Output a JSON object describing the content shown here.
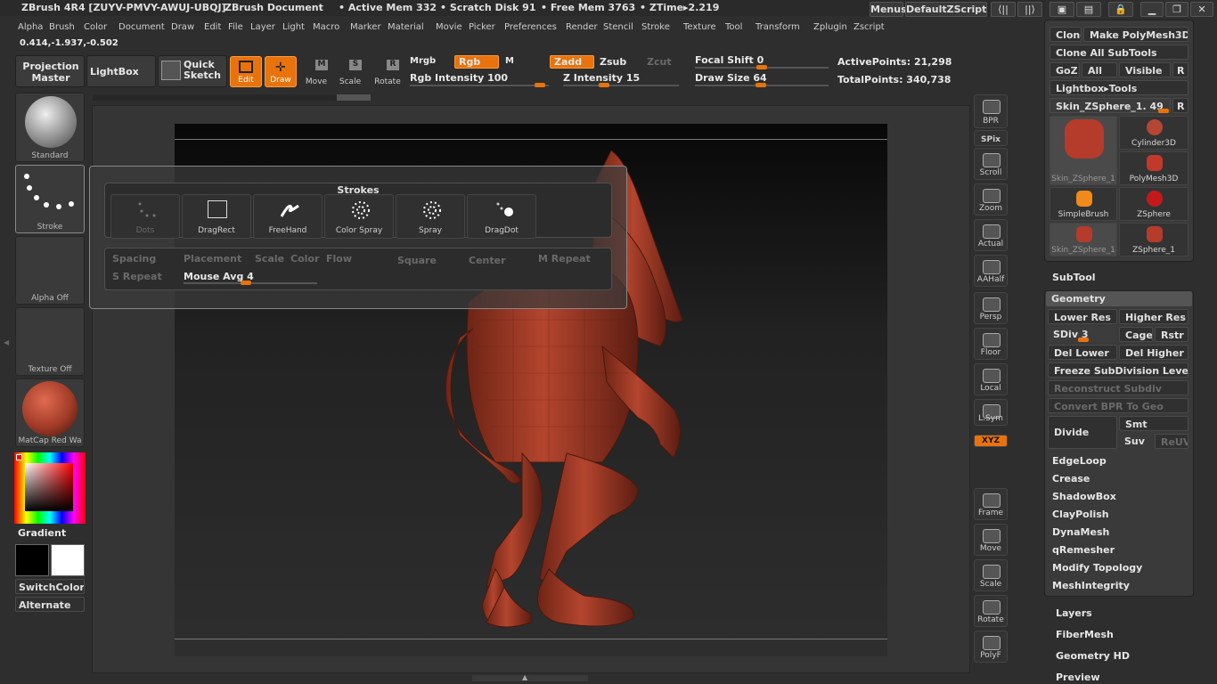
{
  "title_bar": {
    "app": "ZBrush 4R4 [ZUYV-PMVY-AWUJ-UBQJ]",
    "document": "ZBrush Document",
    "active_mem": "• Active Mem 332",
    "scratch": "• Scratch Disk 91",
    "free_mem": "• Free Mem 3763",
    "ztime": "• ZTime▸2.219",
    "menus_label": "Menus",
    "script_label": "DefaultZScript"
  },
  "menu": [
    "Alpha",
    "Brush",
    "Color",
    "Document",
    "Draw",
    "Edit",
    "File",
    "Layer",
    "Light",
    "Macro",
    "Marker",
    "Material",
    "Movie",
    "Picker",
    "Preferences",
    "Render",
    "Stencil",
    "Stroke",
    "Texture",
    "Tool",
    "Transform",
    "Zplugin",
    "Zscript"
  ],
  "coords": "0.414,-1.937,-0.502",
  "toolbar": {
    "projection_master": "Projection Master",
    "lightbox": "LightBox",
    "quick_sketch": "Quick Sketch",
    "edit": "Edit",
    "draw": "Draw",
    "move": "Move",
    "scale": "Scale",
    "rotate": "Rotate",
    "mrgb": "Mrgb",
    "rgb": "Rgb",
    "m": "M",
    "zadd": "Zadd",
    "zsub": "Zsub",
    "zcut": "Zcut",
    "rgb_intensity": "Rgb Intensity 100",
    "z_intensity": "Z Intensity 15",
    "focal_shift": "Focal Shift 0",
    "draw_size": "Draw Size 64",
    "active_points": "ActivePoints: 21,298",
    "total_points": "TotalPoints: 340,738"
  },
  "left": {
    "standard": "Standard",
    "stroke": "Stroke",
    "alpha": "Alpha Off",
    "texture": "Texture Off",
    "matcap": "MatCap Red Wa",
    "gradient": "Gradient",
    "switch_color": "SwitchColor",
    "alternate": "Alternate"
  },
  "popup": {
    "title": "Strokes",
    "strokes": [
      "Dots",
      "DragRect",
      "FreeHand",
      "Color Spray",
      "Spray",
      "DragDot"
    ],
    "options": [
      "Spacing",
      "Placement",
      "Scale",
      "Color",
      "Flow",
      "Square",
      "Center",
      "M Repeat",
      "S Repeat"
    ],
    "mouse_avg": "Mouse Avg 4"
  },
  "right_shelf": [
    "BPR",
    "SPix",
    "Scroll",
    "Zoom",
    "Actual",
    "AAHalf",
    "Persp",
    "Floor",
    "Local",
    "L.Sym",
    "XYZ",
    "Frame",
    "Move",
    "Scale",
    "Rotate",
    "PolyF"
  ],
  "tool_panel": {
    "clone": "Clone",
    "make_polymesh": "Make PolyMesh3D",
    "clone_all": "Clone All SubTools",
    "goz": "GoZ",
    "all": "All",
    "visible": "Visible",
    "r": "R",
    "lightbox_tools": "Lightbox▸Tools",
    "current_tool": "Skin_ZSphere_1. 49",
    "tools": [
      "Skin_ZSphere_1",
      "Cylinder3D",
      "PolyMesh3D",
      "SimpleBrush",
      "ZSphere",
      "Skin_ZSphere_1",
      "ZSphere_1"
    ],
    "subtool": "SubTool",
    "geometry": "Geometry",
    "lower_res": "Lower Res",
    "higher_res": "Higher Res",
    "sdiv": "SDiv 3",
    "cage": "Cage",
    "rstr": "Rstr",
    "del_lower": "Del Lower",
    "del_higher": "Del Higher",
    "freeze": "Freeze SubDivision Levels",
    "reconstruct": "Reconstruct Subdiv",
    "convert_bpr": "Convert BPR To Geo",
    "divide": "Divide",
    "smt": "Smt",
    "suv": "Suv",
    "reuv": "ReUV",
    "geo_items": [
      "EdgeLoop",
      "Crease",
      "ShadowBox",
      "ClayPolish",
      "DynaMesh",
      "qRemesher",
      "Modify Topology",
      "MeshIntegrity"
    ],
    "sections": [
      "Layers",
      "FiberMesh",
      "Geometry HD",
      "Preview"
    ]
  },
  "colors": {
    "accent": "#e8730c",
    "model": "#a13b28",
    "panel": "#3b3b3b"
  }
}
